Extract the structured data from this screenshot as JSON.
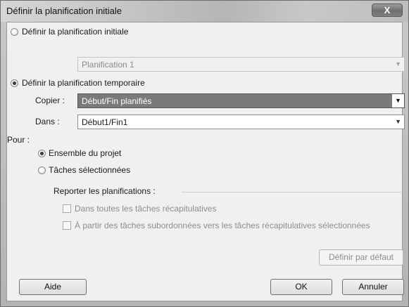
{
  "dialog": {
    "title": "Définir la planification initiale",
    "close_symbol": "X"
  },
  "baseline": {
    "radio_label": "Définir la planification initiale",
    "selected": false,
    "combo_value": "Planification 1"
  },
  "interim": {
    "radio_label": "Définir la planification temporaire",
    "selected": true,
    "copy_label": "Copier :",
    "copy_value": "Début/Fin planifiés",
    "into_label": "Dans :",
    "into_value": "Début1/Fin1"
  },
  "scope": {
    "label": "Pour :",
    "options": [
      {
        "label": "Ensemble du projet",
        "selected": true
      },
      {
        "label": "Tâches sélectionnées",
        "selected": false
      }
    ]
  },
  "rollup": {
    "group_label": "Reporter les planifications :",
    "options": [
      {
        "label": "Dans toutes les tâches récapitulatives",
        "checked": false
      },
      {
        "label": "À partir des tâches subordonnées vers les tâches récapitulatives sélectionnées",
        "checked": false
      }
    ]
  },
  "buttons": {
    "set_default": "Définir par défaut",
    "help": "Aide",
    "ok": "OK",
    "cancel": "Annuler"
  }
}
